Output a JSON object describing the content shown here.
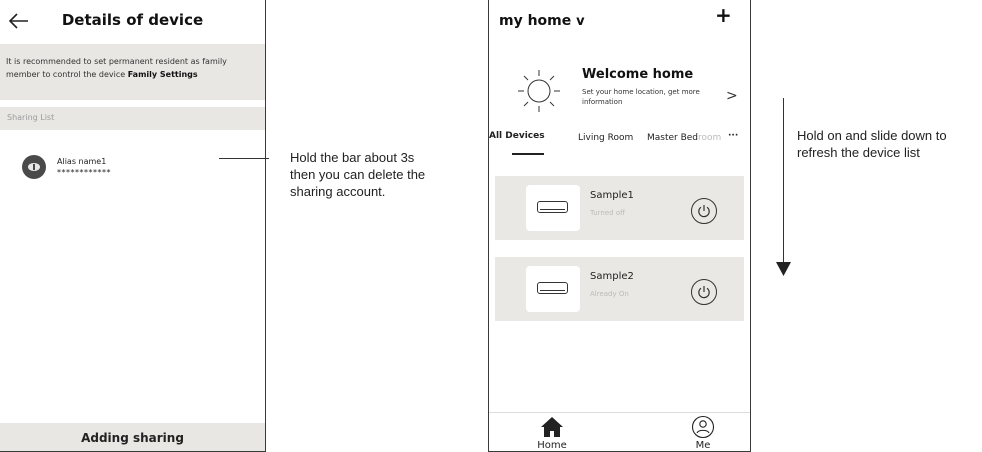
{
  "left_screen": {
    "title": "Details of device",
    "info_text": "It is recommended to set permanent resident as family member to control the device",
    "info_link": "Family Settings",
    "section_label": "Sharing List",
    "sharing": {
      "name": "Alias name1",
      "masked": "************"
    },
    "bottom_button": "Adding sharing"
  },
  "annotations": {
    "left_line1": "Hold the bar about 3s",
    "left_line2": "then you can delete the",
    "left_line3": "sharing account.",
    "right_line1": "Hold on and slide down to",
    "right_line2": "refresh the device list"
  },
  "right_screen": {
    "home_label": "my home",
    "home_chevron": "v",
    "plus": "+",
    "welcome_title": "Welcome home",
    "welcome_sub": "Set your home location, get more information",
    "welcome_arrow": ">",
    "tabs": {
      "all": "All Devices",
      "living": "Living Room",
      "master": "Master Bed",
      "master_fade": "room",
      "more": "···"
    },
    "devices": [
      {
        "name": "Sample1",
        "status": "Turned off"
      },
      {
        "name": "Sample2",
        "status": "Already On"
      }
    ],
    "nav": {
      "home": "Home",
      "me": "Me"
    }
  },
  "colors": {
    "card_bg": "#eae8e5",
    "faint_text": "#bbbbbb"
  }
}
